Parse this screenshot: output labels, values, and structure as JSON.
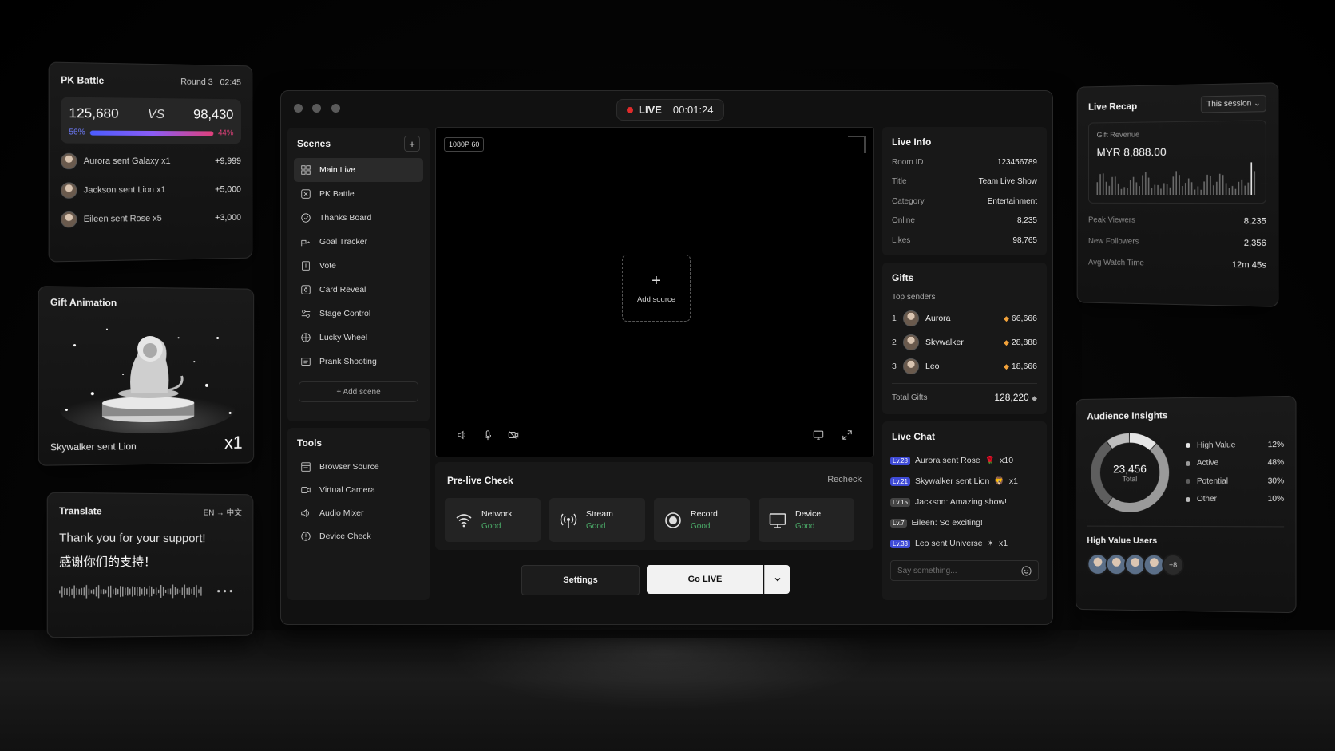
{
  "pk_battle": {
    "title": "PK Battle",
    "round": "Round 3",
    "timer": "02:45",
    "left_score": "125,680",
    "vs": "VS",
    "right_score": "98,430",
    "left_pct": "56%",
    "right_pct": "44%",
    "gifts": [
      {
        "text": "Aurora sent Galaxy x1",
        "amount": "+9,999"
      },
      {
        "text": "Jackson sent Lion x1",
        "amount": "+5,000"
      },
      {
        "text": "Eileen sent Rose x5",
        "amount": "+3,000"
      }
    ]
  },
  "gift_animation": {
    "title": "Gift Animation",
    "caption": "Skywalker sent Lion",
    "multiplier": "x1"
  },
  "translate": {
    "title": "Translate",
    "from": "EN",
    "arrow": "→",
    "to": "中文",
    "source_text": "Thank you for your support!",
    "translated_text": "感谢你们的支持！"
  },
  "window": {
    "live_label": "LIVE",
    "timer": "00:01:24",
    "scenes": {
      "title": "Scenes",
      "add_icon": "+",
      "items": [
        {
          "label": "Main Live",
          "icon": "scene-grid-icon"
        },
        {
          "label": "PK Battle",
          "icon": "pk-icon"
        },
        {
          "label": "Thanks Board",
          "icon": "thanks-icon"
        },
        {
          "label": "Goal Tracker",
          "icon": "goal-icon"
        },
        {
          "label": "Vote",
          "icon": "vote-icon"
        },
        {
          "label": "Card Reveal",
          "icon": "card-icon"
        },
        {
          "label": "Stage Control",
          "icon": "stage-icon"
        },
        {
          "label": "Lucky Wheel",
          "icon": "wheel-icon"
        },
        {
          "label": "Prank Shooting",
          "icon": "target-icon"
        }
      ],
      "add_scene": "+ Add scene"
    },
    "tools": {
      "title": "Tools",
      "items": [
        {
          "label": "Browser Source",
          "icon": "browser-icon"
        },
        {
          "label": "Virtual Camera",
          "icon": "camera-icon"
        },
        {
          "label": "Audio Mixer",
          "icon": "speaker-icon"
        },
        {
          "label": "Device Check",
          "icon": "check-icon"
        }
      ]
    },
    "preview": {
      "resolution": "1080P  60",
      "add_source": "Add source"
    },
    "prelive": {
      "title": "Pre-live Check",
      "recheck": "Recheck",
      "checks": [
        {
          "label": "Network",
          "status": "Good",
          "icon": "wifi-icon"
        },
        {
          "label": "Stream",
          "status": "Good",
          "icon": "broadcast-icon"
        },
        {
          "label": "Record",
          "status": "Good",
          "icon": "record-icon"
        },
        {
          "label": "Device",
          "status": "Good",
          "icon": "monitor-icon"
        }
      ]
    },
    "settings_label": "Settings",
    "golive_label": "Go LIVE",
    "live_info": {
      "title": "Live Info",
      "rows": [
        {
          "k": "Room ID",
          "v": "123456789"
        },
        {
          "k": "Title",
          "v": "Team Live Show"
        },
        {
          "k": "Category",
          "v": "Entertainment"
        },
        {
          "k": "Online",
          "v": "8,235"
        },
        {
          "k": "Likes",
          "v": "98,765"
        }
      ]
    },
    "gifts": {
      "title": "Gifts",
      "subtitle": "Top senders",
      "senders": [
        {
          "rank": "1",
          "name": "Aurora",
          "value": "66,666"
        },
        {
          "rank": "2",
          "name": "Skywalker",
          "value": "28,888"
        },
        {
          "rank": "3",
          "name": "Leo",
          "value": "18,666"
        }
      ],
      "total_label": "Total Gifts",
      "total_value": "128,220"
    },
    "chat": {
      "title": "Live Chat",
      "messages": [
        {
          "lv": "Lv.28",
          "text": "Aurora sent Rose",
          "suffix": "x10",
          "emoji": "🌹",
          "color": "blue"
        },
        {
          "lv": "Lv.21",
          "text": "Skywalker sent Lion",
          "suffix": "x1",
          "emoji": "🦁",
          "color": "blue"
        },
        {
          "lv": "Lv.15",
          "text": "Jackson: Amazing show!",
          "suffix": "",
          "emoji": "",
          "color": "grey"
        },
        {
          "lv": "Lv.7",
          "text": "Eileen: So exciting!",
          "suffix": "",
          "emoji": "",
          "color": "grey"
        },
        {
          "lv": "Lv.33",
          "text": "Leo sent Universe",
          "suffix": "x1",
          "emoji": "✴",
          "color": "blue"
        }
      ],
      "placeholder": "Say something..."
    }
  },
  "recap": {
    "title": "Live Recap",
    "period": "This session",
    "revenue_label": "Gift Revenue",
    "revenue_value": "MYR 8,888.00",
    "stats": [
      {
        "k": "Peak Viewers",
        "v": "8,235"
      },
      {
        "k": "New Followers",
        "v": "2,356"
      },
      {
        "k": "Avg Watch Time",
        "v": "12m 45s"
      }
    ]
  },
  "audience": {
    "title": "Audience Insights",
    "total": "23,456",
    "total_label": "Total",
    "segments": [
      {
        "name": "High Value",
        "pct": "12%",
        "value": 12,
        "color": "#e6e6e6"
      },
      {
        "name": "Active",
        "pct": "48%",
        "value": 48,
        "color": "#9a9a9a"
      },
      {
        "name": "Potential",
        "pct": "30%",
        "value": 30,
        "color": "#5e5e5e"
      },
      {
        "name": "Other",
        "pct": "10%",
        "value": 10,
        "color": "#bdbdbd"
      }
    ],
    "hv_title": "High Value Users",
    "hv_more": "+8"
  }
}
